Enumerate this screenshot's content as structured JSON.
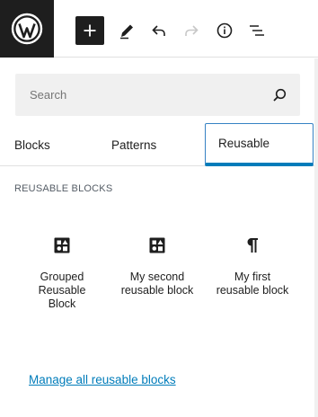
{
  "toolbar": {
    "icons": [
      "wordpress-icon",
      "plus-icon",
      "pencil-icon",
      "undo-icon",
      "redo-icon",
      "info-icon",
      "list-view-icon"
    ]
  },
  "search": {
    "placeholder": "Search",
    "value": ""
  },
  "tabs": [
    {
      "label": "Blocks",
      "active": false
    },
    {
      "label": "Patterns",
      "active": false
    },
    {
      "label": "Reusable",
      "active": true
    }
  ],
  "section": {
    "title": "REUSABLE BLOCKS"
  },
  "blocks": [
    {
      "label": "Grouped Reusable Block",
      "icon": "reusable-block-icon"
    },
    {
      "label": "My second reusable block",
      "icon": "reusable-block-icon"
    },
    {
      "label": "My first reusable block",
      "icon": "paragraph-icon"
    }
  ],
  "manage_link": "Manage all reusable blocks",
  "colors": {
    "accent": "#007cba",
    "dark": "#1e1e1e",
    "search_bg": "#f0f0f0"
  }
}
